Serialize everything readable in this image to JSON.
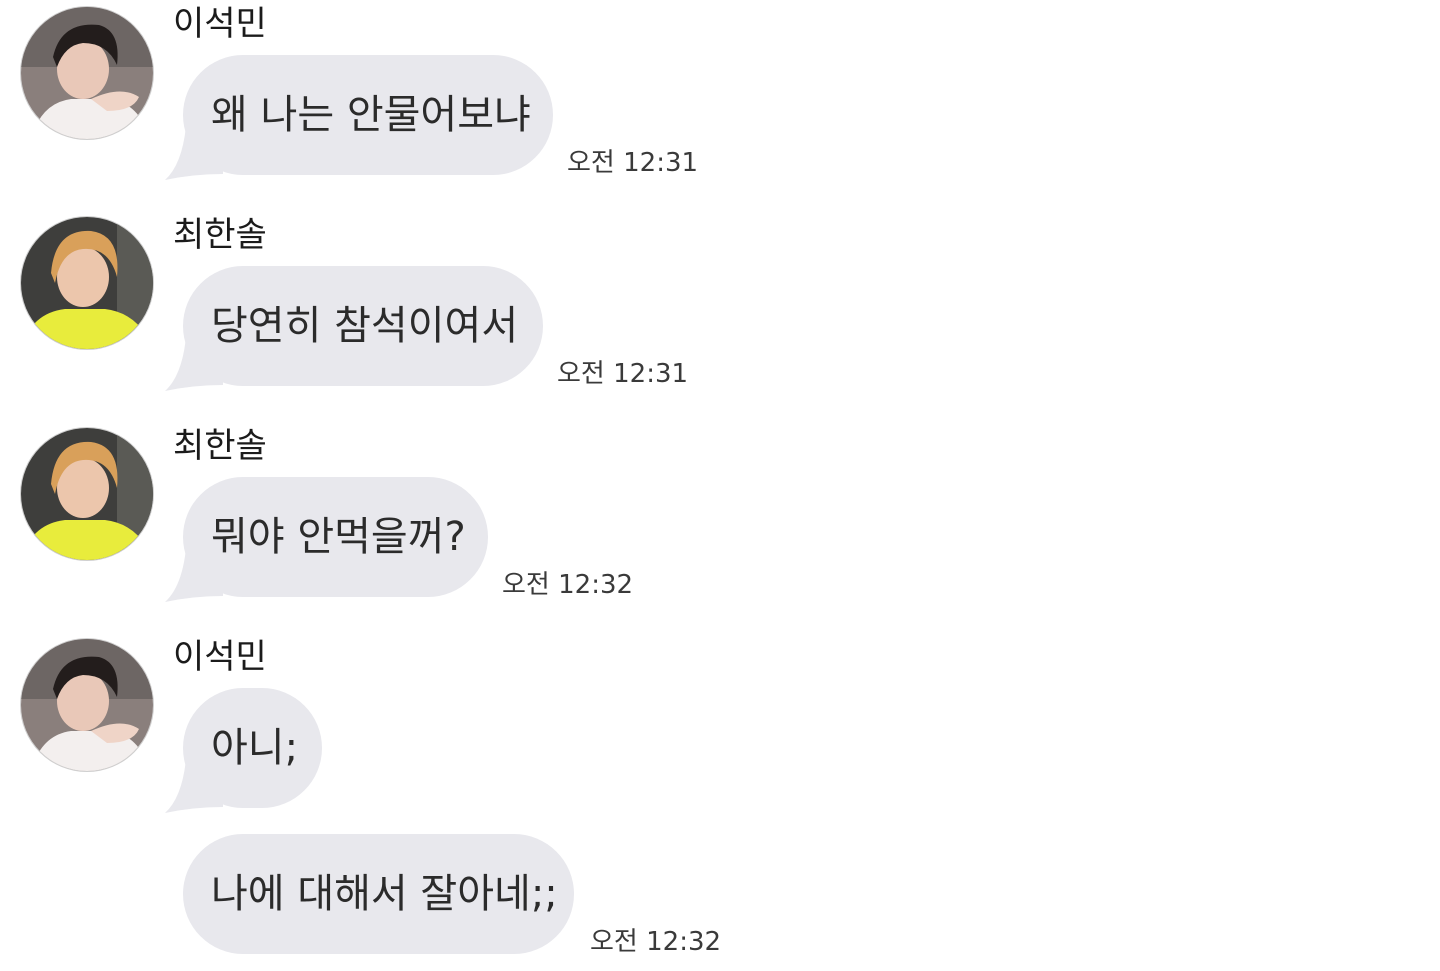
{
  "messages": [
    {
      "sender": "이석민",
      "avatar": "avatar-seokmin",
      "text": "왜 나는 안물어보냐",
      "time": "오전 12:31"
    },
    {
      "sender": "최한솔",
      "avatar": "avatar-hansol",
      "text": "당연히 참석이여서",
      "time": "오전 12:31"
    },
    {
      "sender": "최한솔",
      "avatar": "avatar-hansol",
      "text": "뭐야 안먹을꺼?",
      "time": "오전 12:32"
    },
    {
      "sender": "이석민",
      "avatar": "avatar-seokmin",
      "text": "아니;",
      "time": ""
    },
    {
      "sender": "",
      "avatar": "",
      "text": "나에 대해서 잘아네;;",
      "time": "오전 12:32"
    }
  ],
  "colors": {
    "bubble": "#e8e8ed",
    "text": "#2b2b2b",
    "timestamp": "#3a3a3a",
    "background": "#ffffff"
  }
}
